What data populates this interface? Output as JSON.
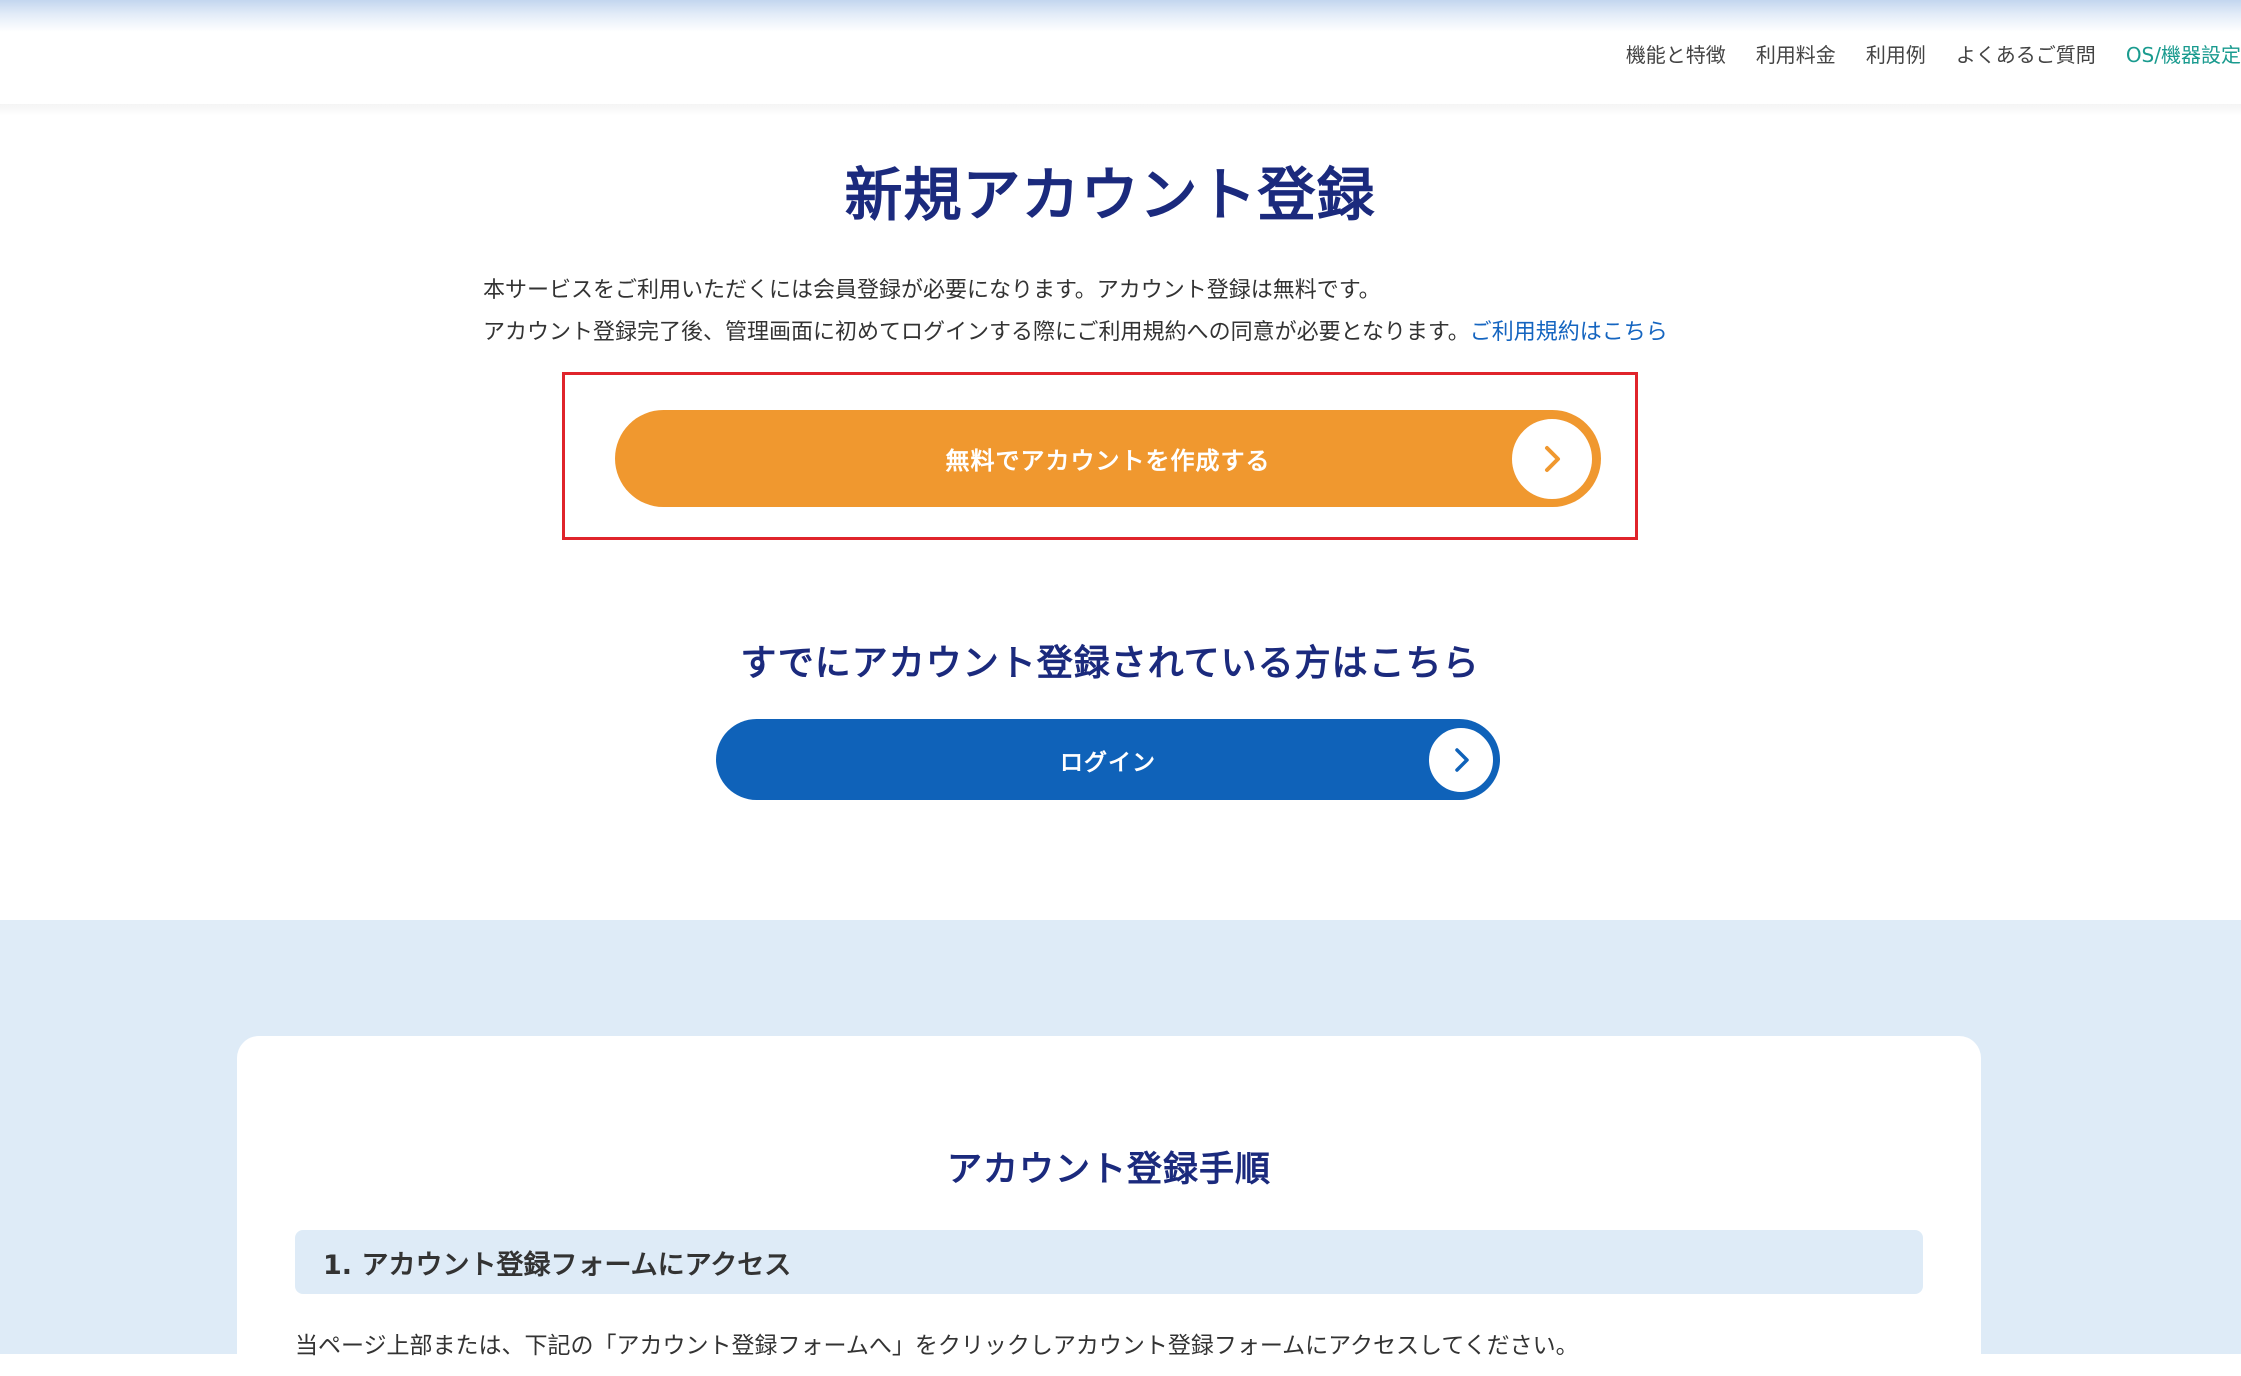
{
  "nav": {
    "items": [
      {
        "label": "機能と特徴"
      },
      {
        "label": "利用料金"
      },
      {
        "label": "利用例"
      },
      {
        "label": "よくあるご質問"
      },
      {
        "label": "OS/機器設定"
      }
    ]
  },
  "main": {
    "title": "新規アカウント登録",
    "intro_line1": "本サービスをご利用いただくには会員登録が必要になります。アカウント登録は無料です。",
    "intro_line2": "アカウント登録完了後、管理画面に初めてログインする際にご利用規約への同意が必要となります。",
    "terms_link": "ご利用規約はこちら",
    "create_button": "無料でアカウントを作成する",
    "existing_heading": "すでにアカウント登録されている方はこちら",
    "login_button": "ログイン"
  },
  "steps": {
    "title": "アカウント登録手順",
    "step1_title": "1. アカウント登録フォームにアクセス",
    "step1_desc": "当ページ上部または、下記の「アカウント登録フォームへ」をクリックしアカウント登録フォームにアクセスしてください。"
  },
  "colors": {
    "heading": "#1b2a7d",
    "create_button": "#f0982f",
    "login_button": "#0f62b9",
    "link": "#1565c0",
    "highlight": "#e0242b",
    "lower_bg": "#deebf7"
  },
  "icons": {
    "create_button_icon": "chevron-right-icon",
    "login_button_icon": "chevron-right-icon"
  }
}
